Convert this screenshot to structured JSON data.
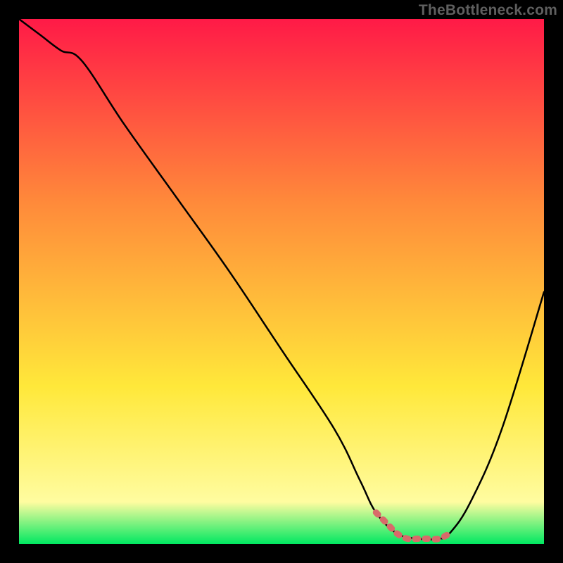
{
  "watermark": "TheBottleneck.com",
  "colors": {
    "frame": "#000000",
    "gradient_top": "#ff1a47",
    "gradient_mid_orange": "#ff8a3a",
    "gradient_yellow": "#ffe83a",
    "gradient_pale_yellow": "#fffca0",
    "gradient_green": "#00e861",
    "curve": "#000000",
    "marker": "#d86a6a"
  },
  "chart_data": {
    "type": "line",
    "title": "",
    "xlabel": "",
    "ylabel": "",
    "xlim": [
      0,
      100
    ],
    "ylim": [
      0,
      100
    ],
    "grid": false,
    "series": [
      {
        "name": "bottleneck-curve",
        "x": [
          0,
          4,
          8,
          12,
          20,
          30,
          40,
          50,
          60,
          65,
          68,
          72,
          76,
          80,
          82,
          86,
          92,
          100
        ],
        "y": [
          100,
          97,
          94,
          92,
          80,
          66,
          52,
          37,
          22,
          12,
          6,
          2,
          1,
          1,
          2,
          8,
          22,
          48
        ]
      }
    ],
    "marker_segment": {
      "name": "optimal-range",
      "x": [
        68,
        70,
        72,
        74,
        76,
        78,
        80,
        82
      ],
      "y": [
        6,
        4,
        2,
        1,
        1,
        1,
        1,
        2
      ]
    }
  }
}
